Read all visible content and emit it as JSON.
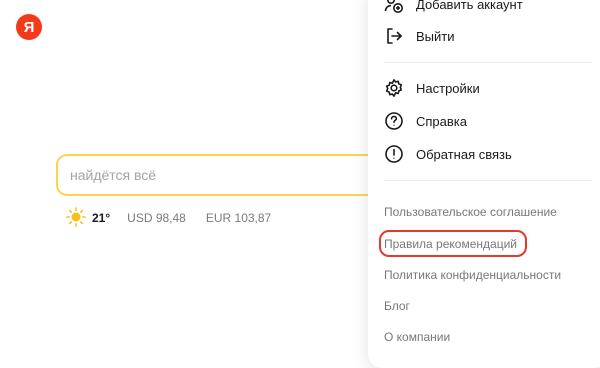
{
  "logo": {
    "letter": "Я"
  },
  "search": {
    "placeholder": "найдётся всё"
  },
  "widgets": {
    "temperature": "21°",
    "usd": "USD 98,48",
    "eur": "EUR 103,87"
  },
  "menu": {
    "items": [
      {
        "label": "Добавить аккаунт",
        "icon": "add-account-icon"
      },
      {
        "label": "Выйти",
        "icon": "logout-icon"
      },
      {
        "label": "Настройки",
        "icon": "gear-icon"
      },
      {
        "label": "Справка",
        "icon": "help-icon"
      },
      {
        "label": "Обратная связь",
        "icon": "feedback-icon"
      }
    ],
    "links": [
      "Пользовательское соглашение",
      "Правила рекомендаций",
      "Политика конфиденциальности",
      "Блог",
      "О компании"
    ],
    "highlight_color": "#e23a2c"
  },
  "colors": {
    "brand": "#f33a1a",
    "search_border": "#ffd24d",
    "sun": "#f8c11a"
  }
}
